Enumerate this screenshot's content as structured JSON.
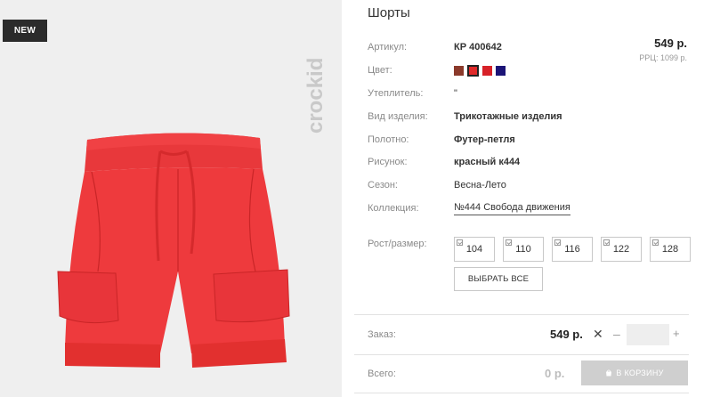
{
  "badge": {
    "label": "NEW"
  },
  "brand": {
    "logo_text": "crockid"
  },
  "product": {
    "title": "Шорты",
    "price": "549 р.",
    "rrp": "РРЦ: 1099 р.",
    "attributes": [
      {
        "label": "Артикул:",
        "value": "КР 400642"
      },
      {
        "label": "Цвет:",
        "value": ""
      },
      {
        "label": "Утеплитель:",
        "value": "\""
      },
      {
        "label": "Вид изделия:",
        "value": "Трикотажные изделия"
      },
      {
        "label": "Полотно:",
        "value": "Футер-петля"
      },
      {
        "label": "Рисунок:",
        "value": "красный к444"
      },
      {
        "label": "Сезон:",
        "value": "Весна-Лето"
      },
      {
        "label": "Коллекция:",
        "value": "№444 Свобода движения"
      }
    ],
    "colors": [
      {
        "name": "brown",
        "hex": "#8b3a2b",
        "selected": false
      },
      {
        "name": "red",
        "hex": "#e02a2a",
        "selected": true
      },
      {
        "name": "red-2",
        "hex": "#d72128",
        "selected": false
      },
      {
        "name": "navy",
        "hex": "#1b1477",
        "selected": false
      }
    ]
  },
  "sizes": {
    "label": "Рост/размер:",
    "options": [
      "104",
      "110",
      "116",
      "122",
      "128"
    ],
    "select_all": "ВЫБРАТЬ ВСЕ"
  },
  "order": {
    "label": "Заказ:",
    "price": "549 р.",
    "times": "✕",
    "minus": "–",
    "plus": "+",
    "qty": ""
  },
  "total": {
    "label": "Всего:",
    "value": "0 р.",
    "cart_button": "В КОРЗИНУ"
  }
}
